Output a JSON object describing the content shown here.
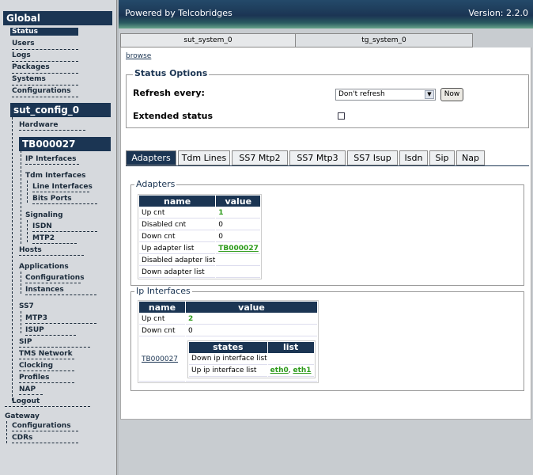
{
  "sidebar": {
    "global": "Global",
    "global_items": [
      "Status",
      "Users",
      "Logs",
      "Packages",
      "Systems",
      "Configurations"
    ],
    "config_name": "sut_config_0",
    "hardware": "Hardware",
    "board": "TB000027",
    "ip_interfaces": "IP Interfaces",
    "tdm_interfaces": "Tdm Interfaces",
    "line_interfaces": "Line Interfaces",
    "bits_ports": "Bits Ports",
    "signaling": "Signaling",
    "isdn": "ISDN",
    "mtp2": "MTP2",
    "hosts": "Hosts",
    "applications": "Applications",
    "app_configurations": "Configurations",
    "instances": "Instances",
    "ss7": "SS7",
    "mtp3": "MTP3",
    "isup": "ISUP",
    "sip": "SIP",
    "tms_network": "TMS Network",
    "clocking": "Clocking",
    "profiles": "Profiles",
    "nap": "NAP",
    "logout": "Logout",
    "gateway": "Gateway",
    "gw_configurations": "Configurations",
    "cdrs": "CDRs"
  },
  "banner": {
    "left": "Powered by Telcobridges",
    "version": "Version: 2.2.0"
  },
  "system_tabs": [
    "sut_system_0",
    "tg_system_0"
  ],
  "browse": "browse",
  "status_options": {
    "title": "Status Options",
    "refresh_label": "Refresh every:",
    "refresh_value": "Don't refresh",
    "now_label": "Now",
    "extended_label": "Extended status"
  },
  "tabs": [
    "Adapters",
    "Tdm Lines",
    "SS7 Mtp2",
    "SS7 Mtp3",
    "SS7 Isup",
    "Isdn",
    "Sip",
    "Nap"
  ],
  "adapters": {
    "title": "Adapters",
    "headers": [
      "name",
      "value"
    ],
    "rows": [
      [
        "Up cnt",
        "1"
      ],
      [
        "Disabled cnt",
        "0"
      ],
      [
        "Down cnt",
        "0"
      ],
      [
        "Up adapter list",
        "TB000027"
      ],
      [
        "Disabled adapter list",
        ""
      ],
      [
        "Down adapter list",
        ""
      ]
    ]
  },
  "ip_interfaces": {
    "title": "Ip Interfaces",
    "headers": [
      "name",
      "value"
    ],
    "up_cnt_label": "Up cnt",
    "up_cnt": "2",
    "down_cnt_label": "Down cnt",
    "down_cnt": "0",
    "board": "TB000027",
    "state_headers": [
      "states",
      "list"
    ],
    "down_list_label": "Down ip interface list",
    "up_list_label": "Up ip interface list",
    "up_list": [
      "eth0",
      "eth1"
    ],
    "separator": ", "
  }
}
